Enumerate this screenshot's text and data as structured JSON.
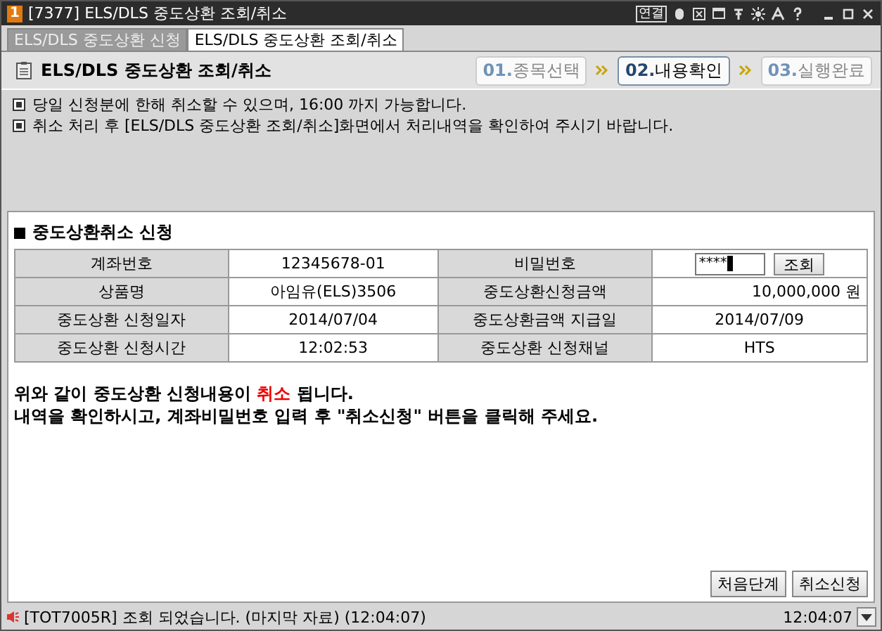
{
  "window": {
    "number": "1",
    "title": "[7377] ELS/DLS 중도상환 조회/취소",
    "toolbar_text": "연결"
  },
  "tabs": [
    {
      "label": "ELS/DLS 중도상환 신청",
      "selected": false
    },
    {
      "label": "ELS/DLS 중도상환 조회/취소",
      "selected": true
    }
  ],
  "header": {
    "title": "ELS/DLS 중도상환 조회/취소",
    "steps": [
      {
        "number": "01.",
        "label": "종목선택",
        "selected": false
      },
      {
        "number": "02.",
        "label": "내용확인",
        "selected": true
      },
      {
        "number": "03.",
        "label": "실행완료",
        "selected": false
      }
    ]
  },
  "notices": [
    "당일 신청분에 한해 취소할 수 있으며, 16:00 까지 가능합니다.",
    "취소 처리 후 [ELS/DLS 중도상환 조회/취소]화면에서 처리내역을 확인하여 주시기 바랍니다."
  ],
  "section": {
    "title": "중도상환취소 신청",
    "rows": [
      [
        {
          "label": "계좌번호",
          "value": "12345678-01",
          "kind": "text"
        },
        {
          "label": "비밀번호",
          "value": "****",
          "button": "조회",
          "kind": "password"
        }
      ],
      [
        {
          "label": "상품명",
          "value": "아임유(ELS)3506",
          "kind": "text"
        },
        {
          "label": "중도상환신청금액",
          "value": "10,000,000 원",
          "kind": "amount"
        }
      ],
      [
        {
          "label": "중도상환 신청일자",
          "value": "2014/07/04",
          "kind": "text"
        },
        {
          "label": "중도상환금액 지급일",
          "value": "2014/07/09",
          "kind": "text"
        }
      ],
      [
        {
          "label": "중도상환 신청시간",
          "value": "12:02:53",
          "kind": "text"
        },
        {
          "label": "중도상환 신청채널",
          "value": "HTS",
          "kind": "text"
        }
      ]
    ]
  },
  "message": [
    [
      {
        "text": "위와 같이 중도상환 신청내용이 ",
        "highlight": false
      },
      {
        "text": "취소",
        "highlight": true
      },
      {
        "text": " 됩니다.",
        "highlight": false
      }
    ],
    [
      {
        "text": "내역을 확인하시고, 계좌비밀번호 입력 후 \"취소신청\" 버튼을 클릭해 주세요.",
        "highlight": false
      }
    ]
  ],
  "buttons": [
    "처음단계",
    "취소신청"
  ],
  "status_bar": {
    "message": "[TOT7005R] 조회 되었습니다. (마지막 자료) (12:04:07)",
    "time": "12:04:07"
  }
}
